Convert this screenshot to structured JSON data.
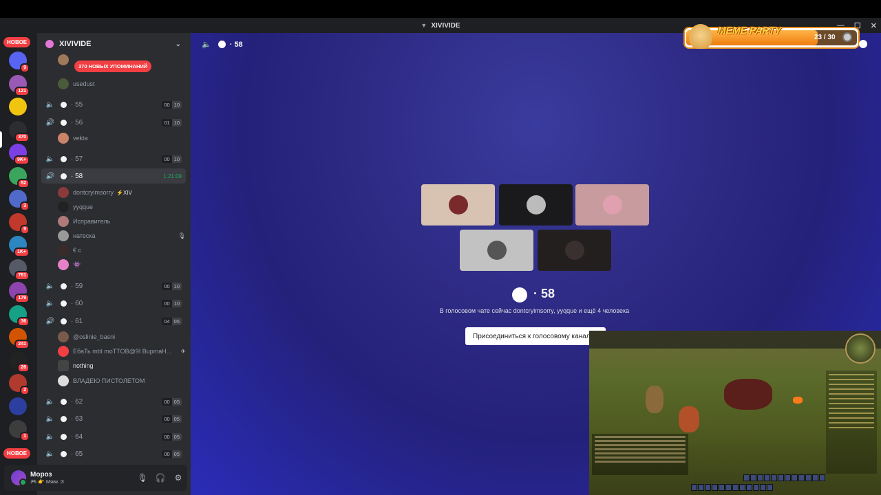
{
  "window": {
    "title": "XIVIVIDE"
  },
  "rail": {
    "new_top": "НОВОЕ",
    "new_bottom": "НОВОЕ",
    "servers": [
      {
        "badge": "9",
        "color": "#5865f2"
      },
      {
        "badge": "121",
        "color": "#9b59b6"
      },
      {
        "badge": "",
        "color": "#f1c40f"
      },
      {
        "badge": "370",
        "color": "#2b2d31"
      },
      {
        "badge": "9K+",
        "color": "#7b3fe4"
      },
      {
        "badge": "52",
        "color": "#3ba55d"
      },
      {
        "badge": "3",
        "color": "#4f6ac9"
      },
      {
        "badge": "9",
        "color": "#c0392b"
      },
      {
        "badge": "1K+",
        "color": "#2e86c1"
      },
      {
        "badge": "761",
        "color": "#555a66"
      },
      {
        "badge": "179",
        "color": "#8e44ad"
      },
      {
        "badge": "36",
        "color": "#16a085"
      },
      {
        "badge": "241",
        "color": "#d35400"
      },
      {
        "badge": "26",
        "color": "#222"
      },
      {
        "badge": "2",
        "color": "#b03a2e"
      },
      {
        "badge": "",
        "color": "#2c3e9e"
      },
      {
        "badge": "1",
        "color": "#3d3d3d"
      }
    ]
  },
  "sidebar": {
    "guild_name": "XIVIVIDE",
    "mention_pill": "370 НОВЫХ УПОМИНАНИЙ",
    "top_member": "usedust",
    "channels": [
      {
        "name": "55",
        "counts": [
          "00",
          "10"
        ]
      },
      {
        "name": "56",
        "counts": [
          "01",
          "10"
        ],
        "members": [
          "vekta"
        ]
      },
      {
        "name": "57",
        "counts": [
          "00",
          "10"
        ]
      },
      {
        "name": "58",
        "timer": "1:21:09"
      },
      {
        "name": "59",
        "counts": [
          "00",
          "10"
        ]
      },
      {
        "name": "60",
        "counts": [
          "00",
          "10"
        ]
      },
      {
        "name": "61",
        "counts": [
          "04",
          "05"
        ]
      },
      {
        "name": "62",
        "counts": [
          "00",
          "05"
        ]
      },
      {
        "name": "63",
        "counts": [
          "00",
          "05"
        ]
      },
      {
        "name": "64",
        "counts": [
          "00",
          "05"
        ]
      },
      {
        "name": "65",
        "counts": [
          "00",
          "05"
        ]
      }
    ],
    "ch58_members": [
      {
        "name": "dontcryimsorry",
        "tag": "⚡XIV"
      },
      {
        "name": "yyqque"
      },
      {
        "name": "Исправитель"
      },
      {
        "name": "натеска"
      },
      {
        "name": "€ c"
      },
      {
        "name": "👾"
      }
    ],
    "ch61_members": [
      {
        "name": "@oslinie_basni"
      },
      {
        "name": "ЕбаТь mbl moTTOB@9I BupmaH..."
      },
      {
        "name": "nothing"
      },
      {
        "name": "ВЛАДЕЮ ПИСТОЛЕТОМ"
      }
    ]
  },
  "user": {
    "name": "Мороз",
    "status": "🎮 👉 Мявк :3"
  },
  "stage": {
    "channel_name": "58",
    "center_title": "58",
    "subtitle": "В голосовом чате сейчас dontcryimsorry, yyqque и ещё 4 человека",
    "join_label": "Присоединиться к голосовому каналу"
  },
  "meme_party": {
    "title": "MEME PARTY",
    "count": "23 / 30",
    "progress": 0.77
  },
  "colors": {
    "accent": "#5865f2",
    "online": "#23a55a",
    "danger": "#f23f43"
  }
}
